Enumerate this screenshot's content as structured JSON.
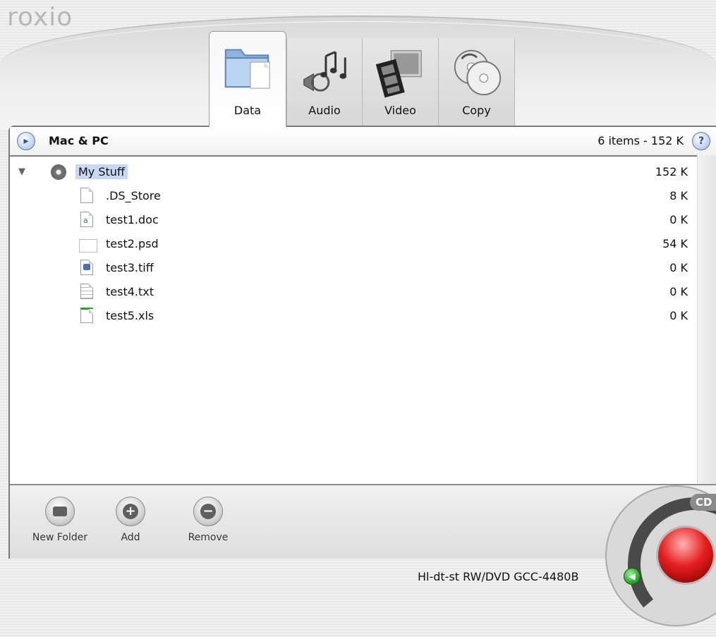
{
  "app": {
    "logo": "roxio"
  },
  "tabs": [
    {
      "label": "Data",
      "icon": "folder-icon",
      "active": true
    },
    {
      "label": "Audio",
      "icon": "music-icon",
      "active": false
    },
    {
      "label": "Video",
      "icon": "film-icon",
      "active": false
    },
    {
      "label": "Copy",
      "icon": "disc-copy-icon",
      "active": false
    }
  ],
  "header": {
    "format_icon": "format-icon",
    "format_label": "Mac & PC",
    "summary": "6 items - 152 K",
    "help_icon": "help-icon",
    "help_glyph": "?"
  },
  "tree": {
    "root": {
      "name": "My Stuff",
      "size": "152 K",
      "icon": "disc-icon",
      "expanded": true
    },
    "files": [
      {
        "name": ".DS_Store",
        "size": "8 K",
        "icon": "generic-file-icon"
      },
      {
        "name": "test1.doc",
        "size": "0 K",
        "icon": "word-doc-icon"
      },
      {
        "name": "test2.psd",
        "size": "54 K",
        "icon": "blank-file-icon"
      },
      {
        "name": "test3.tiff",
        "size": "0 K",
        "icon": "image-file-icon"
      },
      {
        "name": "test4.txt",
        "size": "0 K",
        "icon": "text-file-icon"
      },
      {
        "name": "test5.xls",
        "size": "0 K",
        "icon": "spreadsheet-file-icon"
      }
    ]
  },
  "toolbar": {
    "new_folder": "New Folder",
    "add": "Add",
    "remove": "Remove"
  },
  "burn": {
    "media_badge": "CD",
    "button_color": "#e62020"
  },
  "drive": {
    "label": "Hl-dt-st RW/DVD GCC-4480B",
    "eject_icon": "drive-select-icon"
  }
}
